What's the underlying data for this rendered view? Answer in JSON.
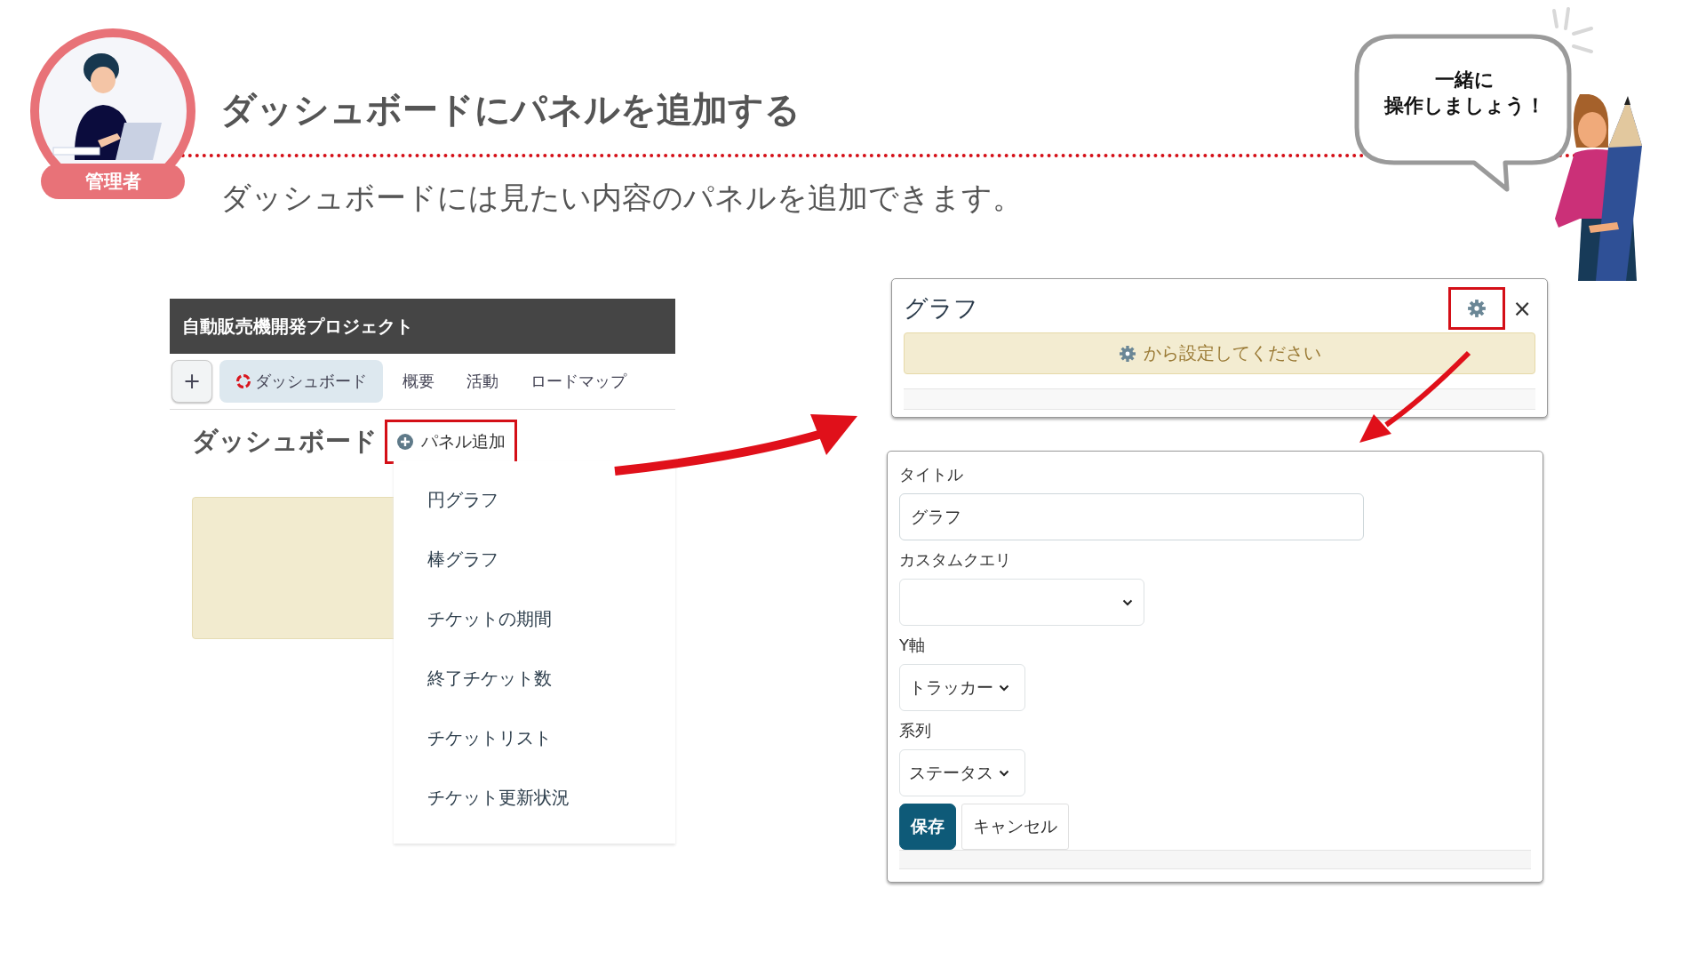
{
  "presenter": {
    "role": "管理者"
  },
  "title": "ダッシュボードにパネルを追加する",
  "subtitle": "ダッシュボードには見たい内容のパネルを追加できます。",
  "speech_bubble": {
    "lines": [
      "一緒に",
      "操作しましょう！"
    ]
  },
  "app": {
    "project_title": "自動販売機開発プロジェクト",
    "add_button": "+",
    "tabs": [
      {
        "label": "ダッシュボード",
        "selected": true,
        "kind": "dashboard"
      },
      {
        "label": "概要",
        "selected": false,
        "kind": "plain"
      },
      {
        "label": "活動",
        "selected": false,
        "kind": "plain"
      },
      {
        "label": "ロードマップ",
        "selected": false,
        "kind": "plain"
      }
    ],
    "heading": "ダッシュボード",
    "add_panel_button": {
      "label": "パネル追加",
      "highlighted": true
    },
    "menu_items": [
      "円グラフ",
      "棒グラフ",
      "チケットの期間",
      "終了チケット数",
      "チケットリスト",
      "チケット更新状況"
    ]
  },
  "panel": {
    "title": "グラフ",
    "settings_highlighted": true,
    "close": "×",
    "notice": "から設定してください"
  },
  "form": {
    "fields": [
      {
        "label": "タイトル",
        "kind": "text",
        "value": "グラフ"
      },
      {
        "label": "カスタムクエリ",
        "kind": "select"
      },
      {
        "label": "Y軸",
        "kind": "picker",
        "value": "トラッカー"
      },
      {
        "label": "系列",
        "kind": "picker",
        "value": "ステータス"
      }
    ],
    "buttons": [
      {
        "label": "保存",
        "kind": "primary"
      },
      {
        "label": "キャンセル",
        "kind": "secondary"
      }
    ]
  }
}
